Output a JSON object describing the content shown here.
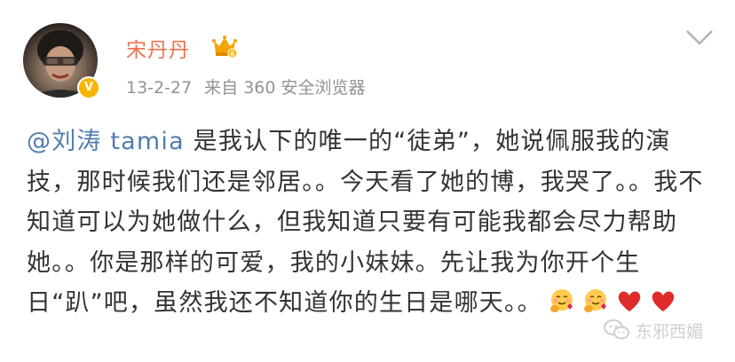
{
  "post": {
    "username": "宋丹丹",
    "date": "13-2-27",
    "source": "来自 360 安全浏览器",
    "mention": "@刘涛 tamia",
    "body": " 是我认下的唯一的“徒弟”，她说佩服我的演技，那时候我们还是邻居。。今天看了她的博，我哭了。。我不知道可以为她做什么，但我知道只要有可能我都会尽力帮助她。。你是那样的可爱，我的小妹妹。先让我为你开个生日“趴”吧，虽然我还不知道你的生日是哪天。。",
    "emojis": [
      "hug-face-emoji",
      "hug-face-emoji",
      "red-heart-emoji",
      "red-heart-emoji"
    ],
    "verified_badge": "V"
  },
  "watermark": {
    "text": "东邪西媚"
  },
  "colors": {
    "username": "#eb7350",
    "mention": "#507daf",
    "meta": "#939393",
    "text": "#333333"
  }
}
